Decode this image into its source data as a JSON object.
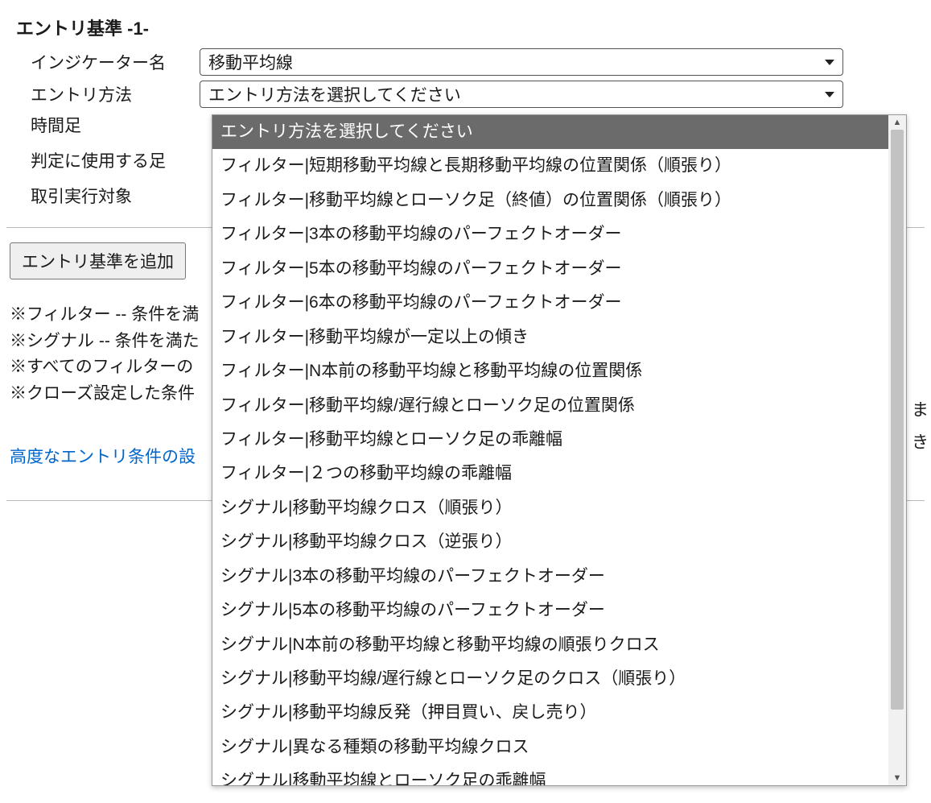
{
  "section_title": "エントリ基準 -1-",
  "rows": {
    "indicator_label": "インジケーター名",
    "indicator_value": "移動平均線",
    "entry_method_label": "エントリ方法",
    "entry_method_value": "エントリ方法を選択してください",
    "timeframe_label": "時間足",
    "judge_bar_label": "判定に使用する足",
    "exec_target_label": "取引実行対象"
  },
  "add_button_label": "エントリ基準を追加",
  "notes": {
    "n1": "※フィルター -- 条件を満",
    "n2": "※シグナル  -- 条件を満た",
    "n3": "※すべてのフィルターの",
    "n4": "※クローズ設定した条件"
  },
  "advanced_link": "高度なエントリ条件の設",
  "truncated_right": {
    "r1": "ま",
    "r2": "き"
  },
  "dropdown": {
    "options": [
      {
        "label": "エントリ方法を選択してください",
        "selected": true
      },
      {
        "label": "フィルター|短期移動平均線と長期移動平均線の位置関係（順張り）"
      },
      {
        "label": "フィルター|移動平均線とローソク足（終値）の位置関係（順張り）"
      },
      {
        "label": "フィルター|3本の移動平均線のパーフェクトオーダー"
      },
      {
        "label": "フィルター|5本の移動平均線のパーフェクトオーダー"
      },
      {
        "label": "フィルター|6本の移動平均線のパーフェクトオーダー"
      },
      {
        "label": "フィルター|移動平均線が一定以上の傾き"
      },
      {
        "label": "フィルター|N本前の移動平均線と移動平均線の位置関係"
      },
      {
        "label": "フィルター|移動平均線/遅行線とローソク足の位置関係"
      },
      {
        "label": "フィルター|移動平均線とローソク足の乖離幅"
      },
      {
        "label": "フィルター|２つの移動平均線の乖離幅"
      },
      {
        "label": "シグナル|移動平均線クロス（順張り）"
      },
      {
        "label": "シグナル|移動平均線クロス（逆張り）"
      },
      {
        "label": "シグナル|3本の移動平均線のパーフェクトオーダー"
      },
      {
        "label": "シグナル|5本の移動平均線のパーフェクトオーダー"
      },
      {
        "label": "シグナル|N本前の移動平均線と移動平均線の順張りクロス"
      },
      {
        "label": "シグナル|移動平均線/遅行線とローソク足のクロス（順張り）"
      },
      {
        "label": "シグナル|移動平均線反発（押目買い、戻し売り）"
      },
      {
        "label": "シグナル|異なる種類の移動平均線クロス"
      },
      {
        "label": "シグナル|移動平均線とローソク足の乖離幅"
      }
    ]
  }
}
